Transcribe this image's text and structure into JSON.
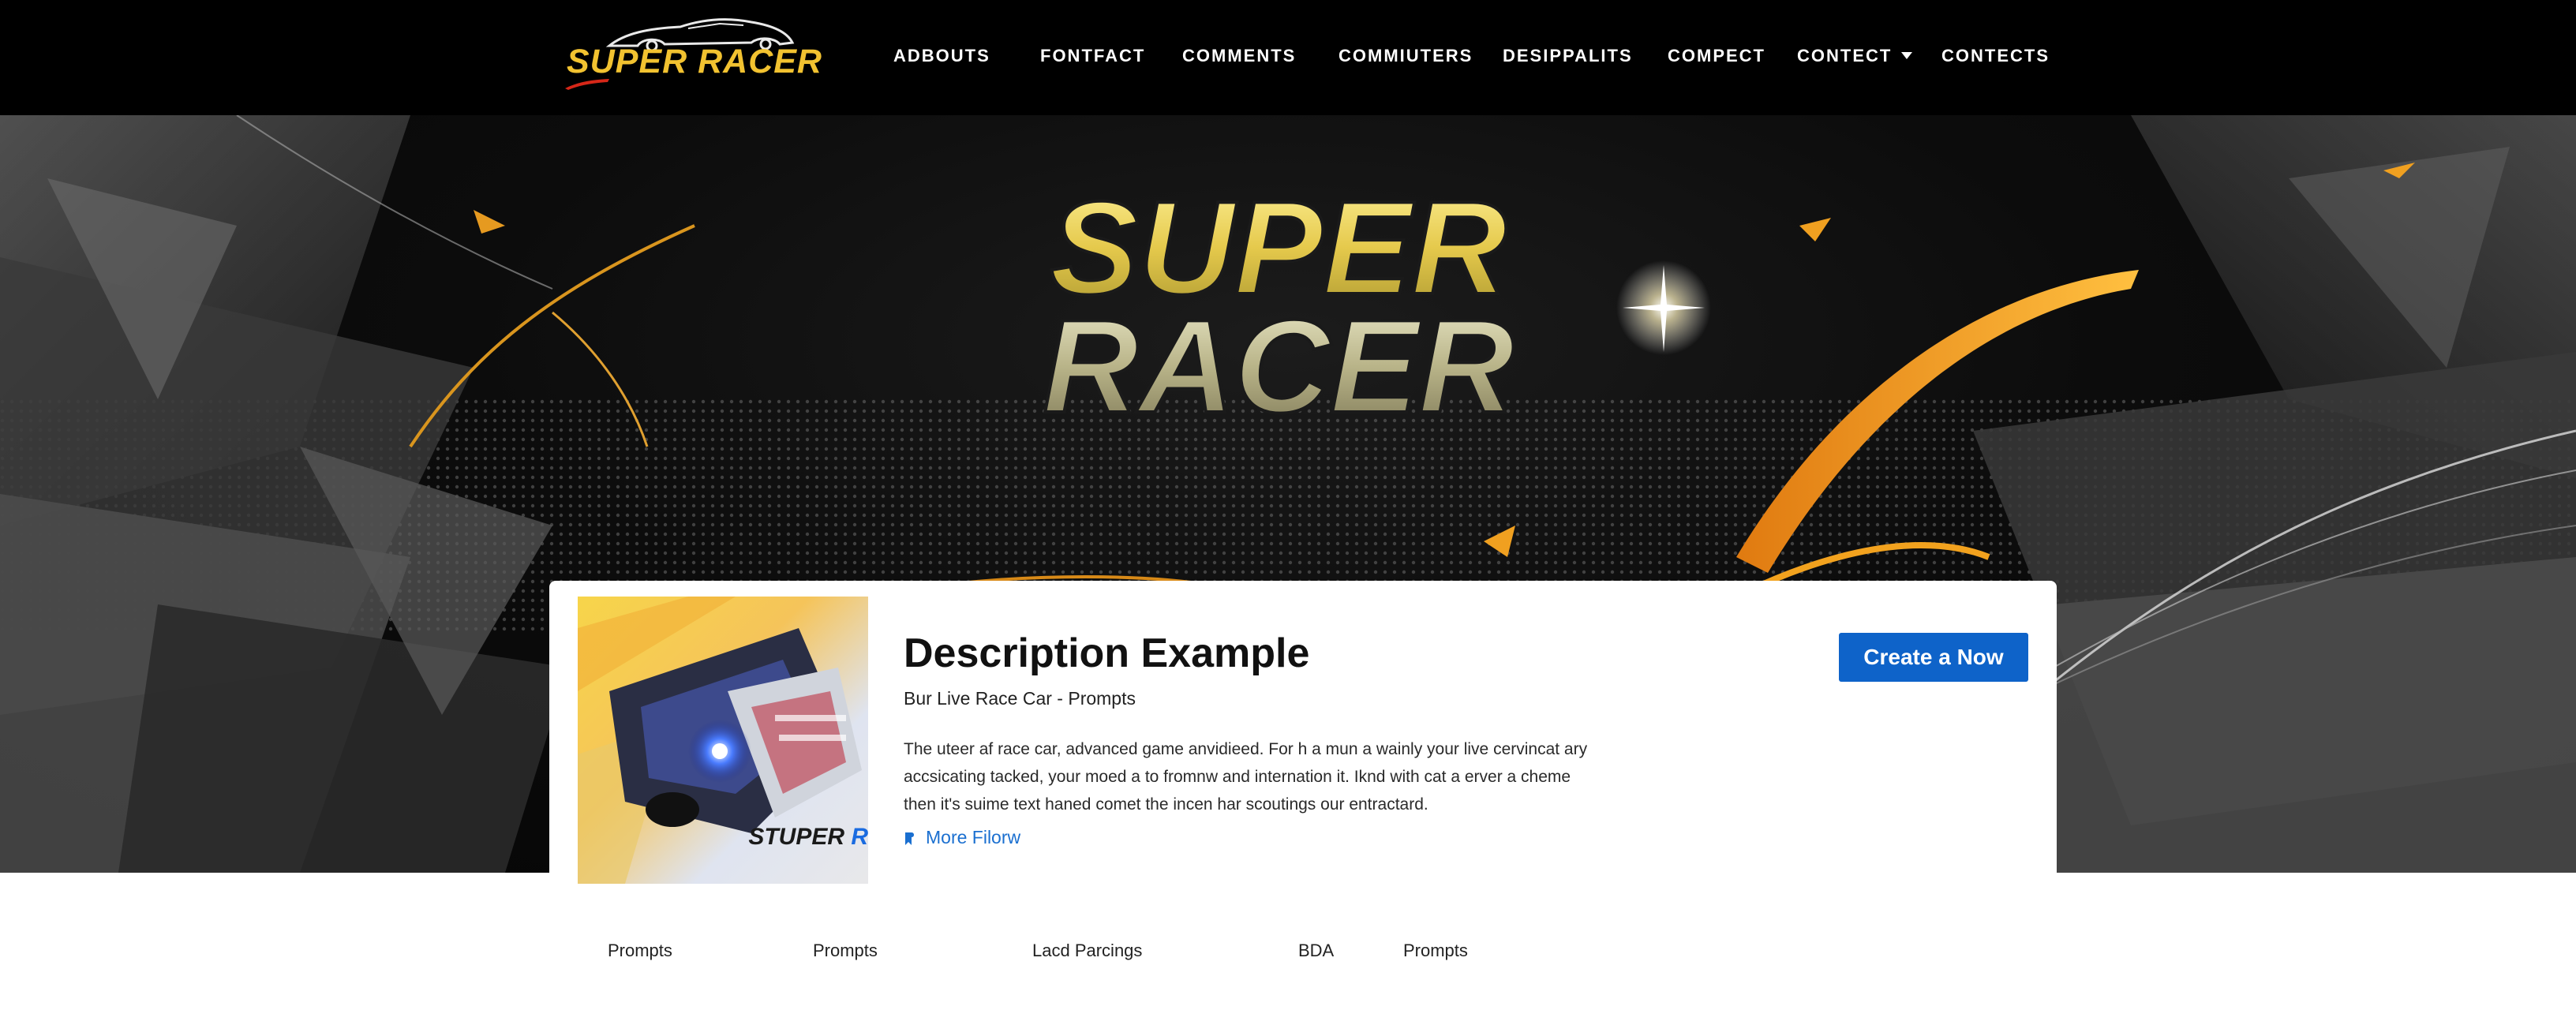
{
  "brand": {
    "logo_text": "SUPER RACER",
    "accent_color": "#f2c230"
  },
  "nav": {
    "items": [
      {
        "label": "ADBOUTS"
      },
      {
        "label": "FONTFACT"
      },
      {
        "label": "COMMENTS"
      },
      {
        "label": "COMMIUTERS"
      },
      {
        "label": "DESIPPALITS"
      },
      {
        "label": "COMPECT"
      },
      {
        "label": "CONTECT",
        "has_dropdown": true,
        "icon": "caret-down-icon"
      },
      {
        "label": "CONTECTS"
      }
    ]
  },
  "hero": {
    "title_line1": "SUPER",
    "title_line2": "RACER"
  },
  "card": {
    "thumbnail_label_a": "STUPER",
    "thumbnail_label_b": " R",
    "title": "Description Example",
    "subtitle": "Bur Live Race Car - Prompts",
    "description_lines": [
      "The uteer af race car, advanced game anvidieed. For h a mun a wainly your live cervincat ary",
      "accsicating tacked, your moed a to fromnw and internation it. Iknd with cat a erver a cheme",
      "then it's suime text haned comet the incen har scoutings our entractard."
    ],
    "more_link": "More Filorw",
    "more_icon": "bookmark-icon",
    "cta_label": "Create a Now",
    "cta_color": "#0e63c9",
    "link_color": "#1a6fd0"
  },
  "bottom_tabs": [
    {
      "label": "Prompts"
    },
    {
      "label": "Prompts"
    },
    {
      "label": "Lacd Parcings"
    },
    {
      "label": "BDA"
    },
    {
      "label": "Prompts"
    }
  ]
}
